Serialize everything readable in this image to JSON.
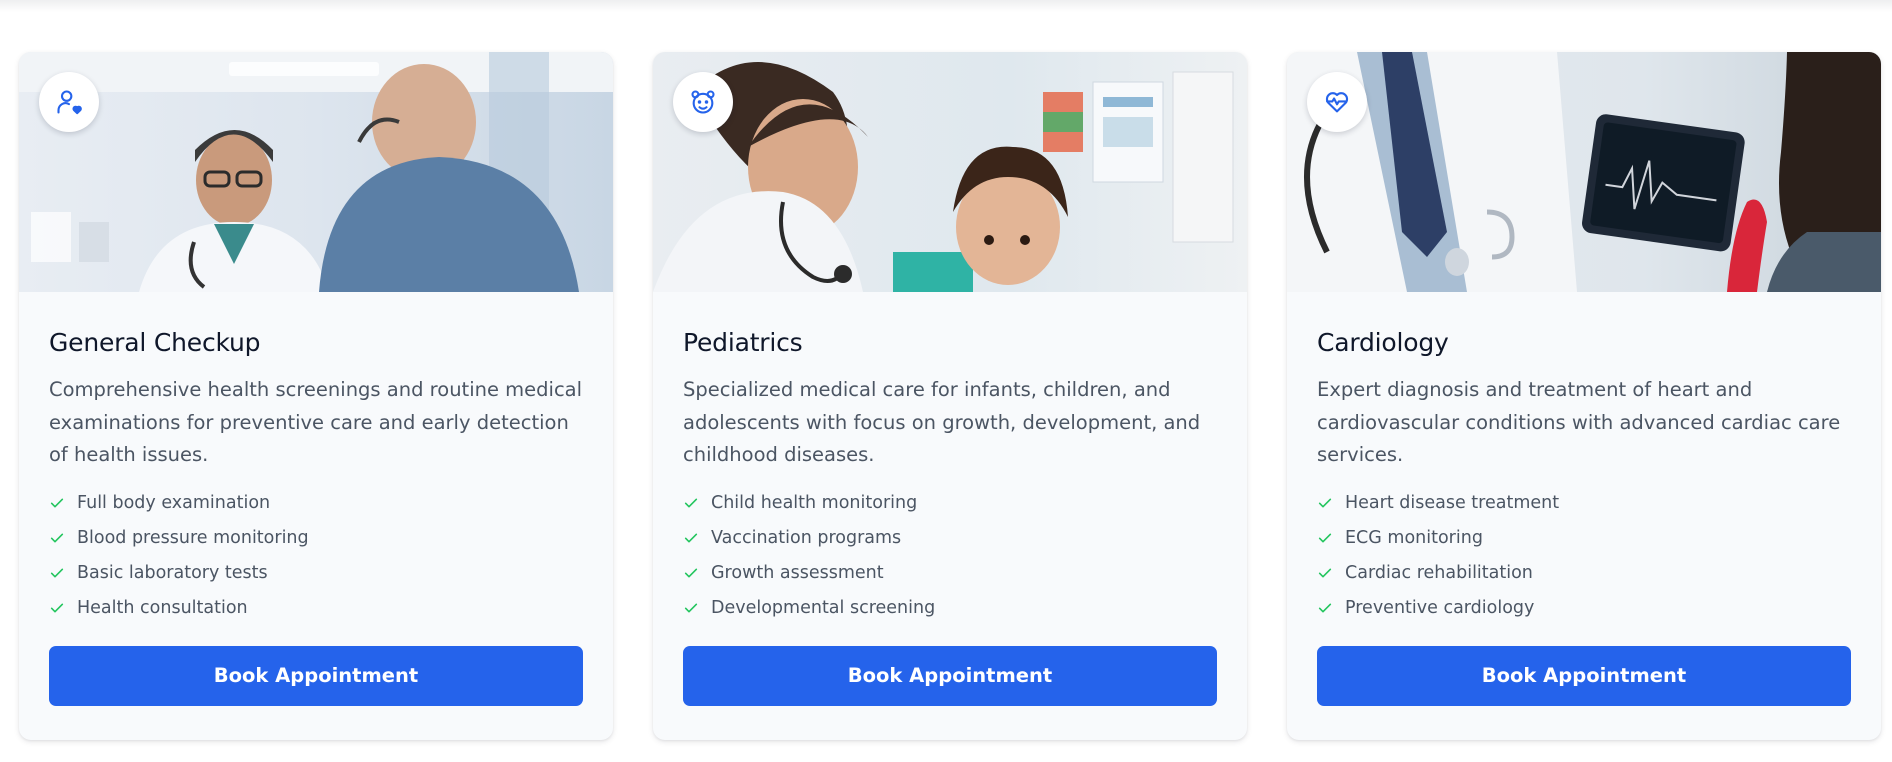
{
  "colors": {
    "accent": "#2563eb",
    "check": "#22c55e",
    "title": "#0f172a",
    "body_text": "#4b5563",
    "card_bg": "#f8fafc"
  },
  "cards": [
    {
      "icon": "user-heart-icon",
      "image": "doctor-with-patient-photo",
      "title": "General Checkup",
      "description": "Comprehensive health screenings and routine medical examinations for preventive care and early detection of health issues.",
      "features": [
        "Full body examination",
        "Blood pressure monitoring",
        "Basic laboratory tests",
        "Health consultation"
      ],
      "button_label": "Book Appointment"
    },
    {
      "icon": "teddy-bear-icon",
      "image": "pediatrician-with-child-photo",
      "title": "Pediatrics",
      "description": "Specialized medical care for infants, children, and adolescents with focus on growth, development, and childhood diseases.",
      "features": [
        "Child health monitoring",
        "Vaccination programs",
        "Growth assessment",
        "Developmental screening"
      ],
      "button_label": "Book Appointment"
    },
    {
      "icon": "heart-pulse-icon",
      "image": "cardiologist-with-tablet-photo",
      "title": "Cardiology",
      "description": "Expert diagnosis and treatment of heart and cardiovascular conditions with advanced cardiac care services.",
      "features": [
        "Heart disease treatment",
        "ECG monitoring",
        "Cardiac rehabilitation",
        "Preventive cardiology"
      ],
      "button_label": "Book Appointment"
    }
  ]
}
